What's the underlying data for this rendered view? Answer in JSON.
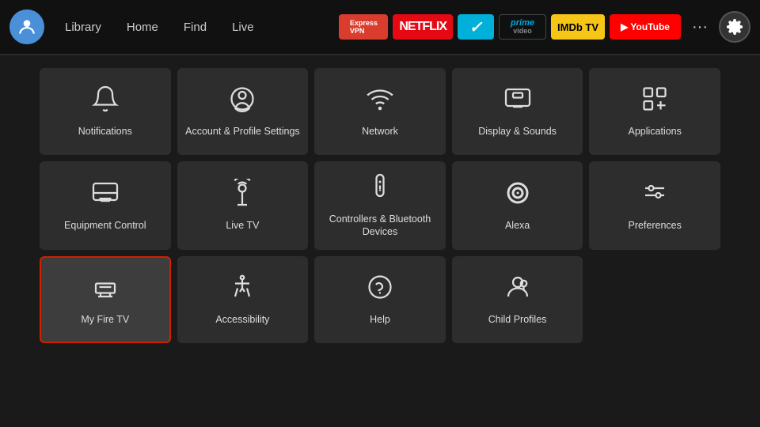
{
  "nav": {
    "links": [
      "Library",
      "Home",
      "Find",
      "Live"
    ],
    "apps": [
      {
        "id": "expressvpn",
        "label": "ExpressVPN",
        "class": "badge-express"
      },
      {
        "id": "netflix",
        "label": "NETFLIX",
        "class": "badge-netflix"
      },
      {
        "id": "freevee",
        "label": "✓",
        "class": "badge-freevee"
      },
      {
        "id": "prime",
        "label": "prime\nvideo",
        "class": "badge-prime"
      },
      {
        "id": "imdb",
        "label": "IMDb TV",
        "class": "badge-imdb"
      },
      {
        "id": "youtube",
        "label": "▶ YouTube",
        "class": "badge-youtube"
      }
    ],
    "more_label": "···",
    "settings_label": "⚙"
  },
  "grid": {
    "items": [
      {
        "id": "notifications",
        "label": "Notifications",
        "icon": "bell"
      },
      {
        "id": "account-profile",
        "label": "Account & Profile Settings",
        "icon": "person-circle"
      },
      {
        "id": "network",
        "label": "Network",
        "icon": "wifi"
      },
      {
        "id": "display-sounds",
        "label": "Display & Sounds",
        "icon": "display"
      },
      {
        "id": "applications",
        "label": "Applications",
        "icon": "apps"
      },
      {
        "id": "equipment-control",
        "label": "Equipment Control",
        "icon": "monitor"
      },
      {
        "id": "live-tv",
        "label": "Live TV",
        "icon": "antenna"
      },
      {
        "id": "controllers-bluetooth",
        "label": "Controllers & Bluetooth Devices",
        "icon": "remote"
      },
      {
        "id": "alexa",
        "label": "Alexa",
        "icon": "alexa"
      },
      {
        "id": "preferences",
        "label": "Preferences",
        "icon": "sliders"
      },
      {
        "id": "my-fire-tv",
        "label": "My Fire TV",
        "icon": "firetv",
        "selected": true
      },
      {
        "id": "accessibility",
        "label": "Accessibility",
        "icon": "accessibility"
      },
      {
        "id": "help",
        "label": "Help",
        "icon": "help"
      },
      {
        "id": "child-profiles",
        "label": "Child Profiles",
        "icon": "child-profiles"
      },
      {
        "id": "empty",
        "label": "",
        "icon": "none"
      }
    ]
  },
  "colors": {
    "selected_border": "#cc2200",
    "grid_bg": "#2d2d2d",
    "nav_bg": "#111"
  }
}
